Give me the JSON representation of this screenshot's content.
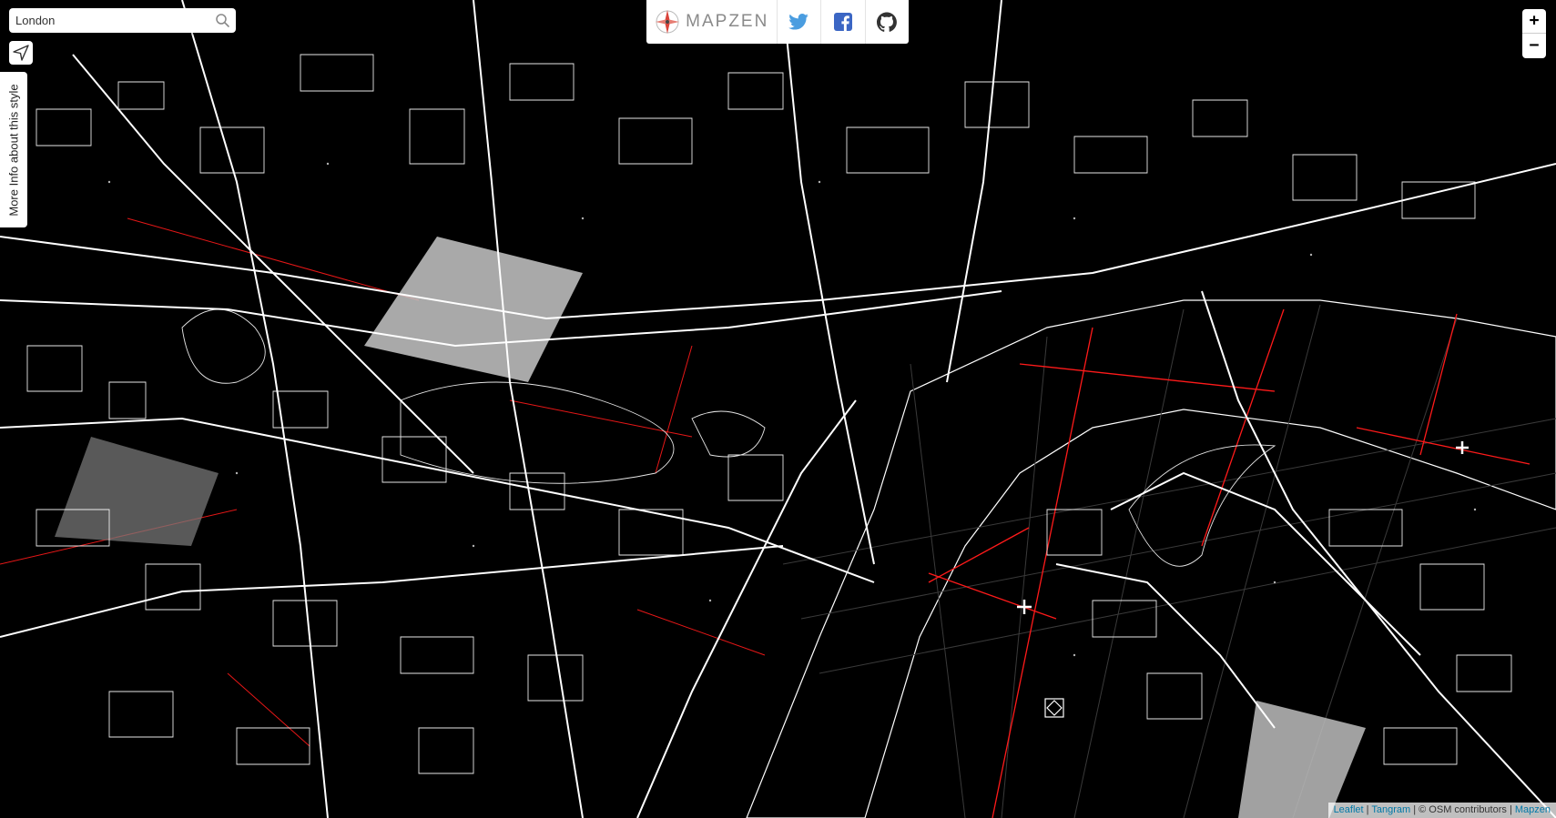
{
  "search": {
    "value": "London",
    "placeholder": "Search"
  },
  "info_tab": {
    "label": "More Info about this style"
  },
  "topbar": {
    "brand_text": "MAPZEN",
    "twitter_icon": "twitter-icon",
    "facebook_icon": "facebook-icon",
    "github_icon": "github-icon"
  },
  "zoom": {
    "in_label": "+",
    "out_label": "−"
  },
  "attribution": {
    "leaflet": "Leaflet",
    "sep1": " | ",
    "tangram": "Tangram",
    "osm": " | © OSM contributors | ",
    "mapzen": "Mapzen"
  },
  "colors": {
    "background": "#000000",
    "streets": "#ffffff",
    "grid": "#ff1a1a",
    "park": "#bfbfbf",
    "accent_link": "#0078A8"
  }
}
